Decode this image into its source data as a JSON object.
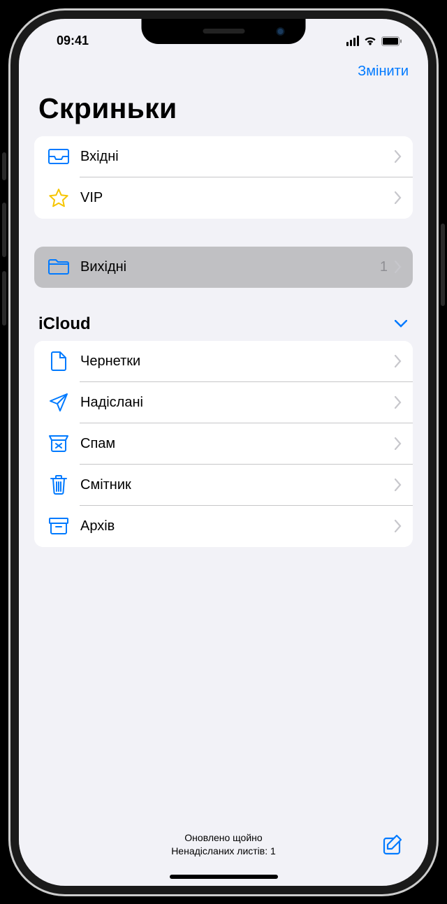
{
  "status": {
    "time": "09:41"
  },
  "nav": {
    "edit": "Змінити"
  },
  "title": "Скриньки",
  "favorites": {
    "inbox": "Вхідні",
    "vip": "VIP"
  },
  "outbox": {
    "label": "Вихідні",
    "count": "1"
  },
  "icloud": {
    "title": "iCloud",
    "drafts": "Чернетки",
    "sent": "Надіслані",
    "spam": "Спам",
    "trash": "Смітник",
    "archive": "Архів"
  },
  "footer": {
    "line1": "Оновлено щойно",
    "line2": "Ненадісланих листів: 1"
  }
}
